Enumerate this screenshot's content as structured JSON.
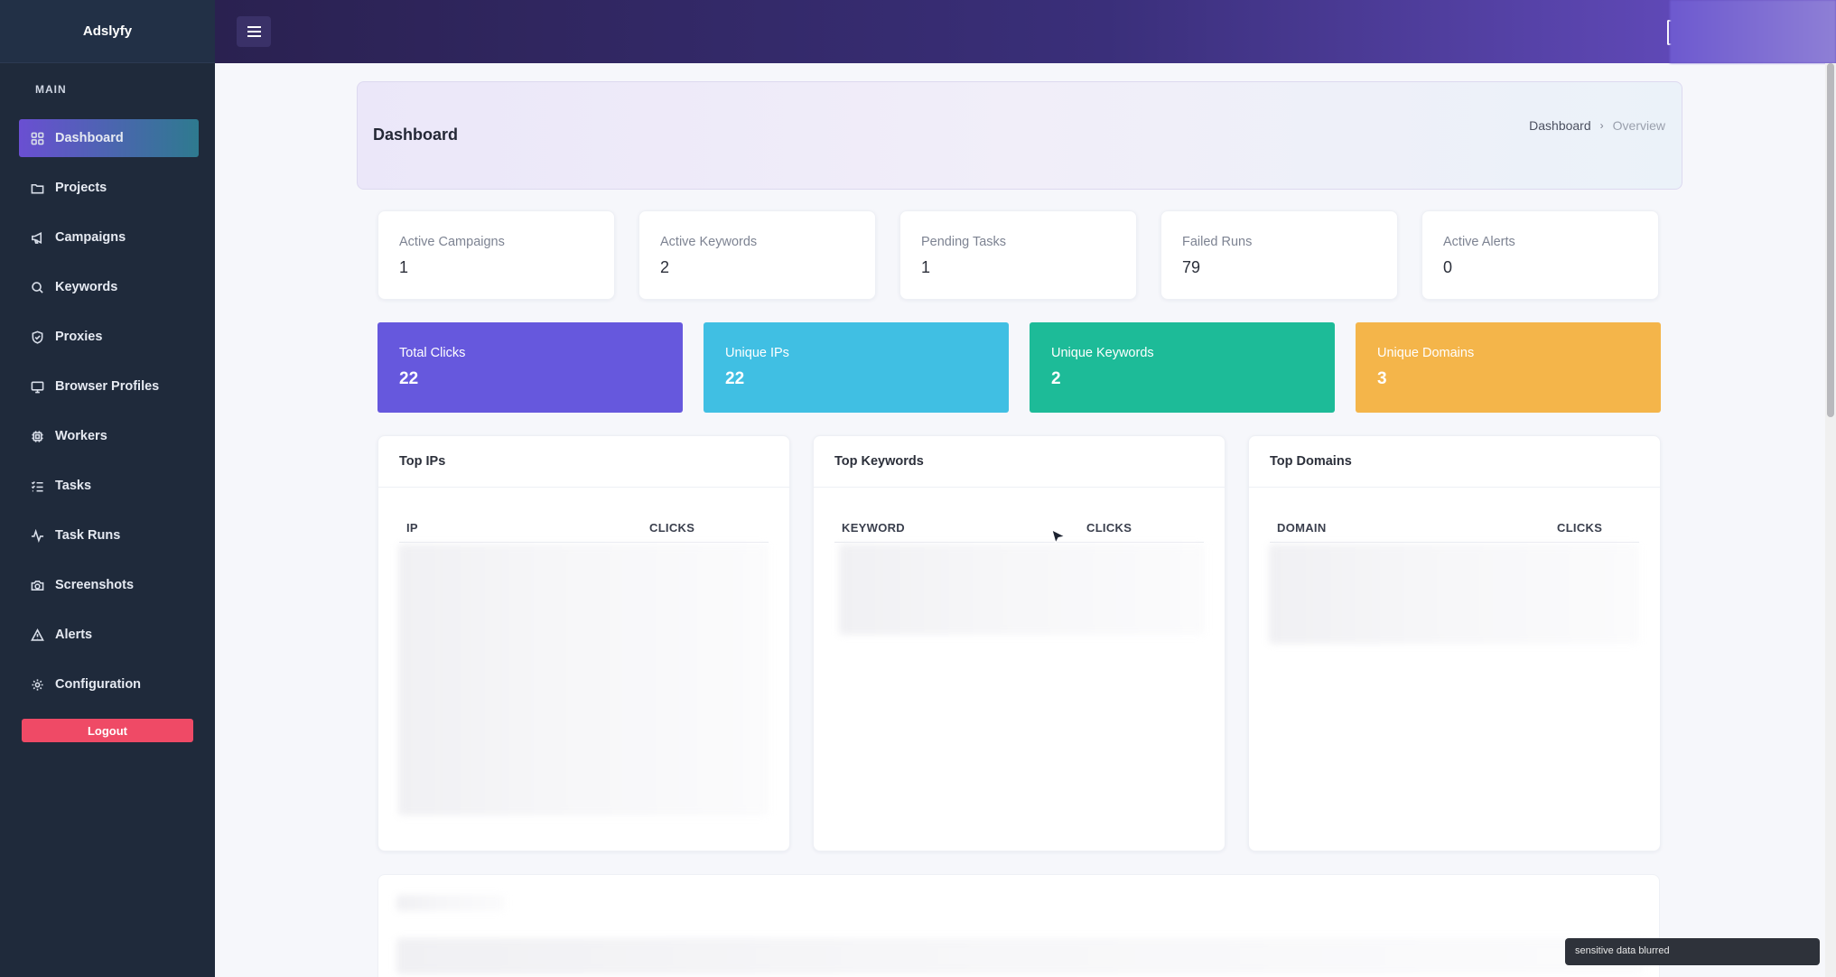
{
  "app": {
    "name": "Adslyfy"
  },
  "sidebar": {
    "section_label": "MAIN",
    "items": [
      {
        "label": "Dashboard",
        "icon": "grid-icon",
        "active": true
      },
      {
        "label": "Projects",
        "icon": "folder-icon"
      },
      {
        "label": "Campaigns",
        "icon": "megaphone-icon"
      },
      {
        "label": "Keywords",
        "icon": "search-icon"
      },
      {
        "label": "Proxies",
        "icon": "shield-icon"
      },
      {
        "label": "Browser Profiles",
        "icon": "monitor-icon"
      },
      {
        "label": "Workers",
        "icon": "cpu-icon"
      },
      {
        "label": "Tasks",
        "icon": "list-checks-icon"
      },
      {
        "label": "Task Runs",
        "icon": "activity-icon"
      },
      {
        "label": "Screenshots",
        "icon": "camera-icon"
      },
      {
        "label": "Alerts",
        "icon": "alert-triangle-icon"
      },
      {
        "label": "Configuration",
        "icon": "gear-icon"
      }
    ],
    "logout_label": "Logout"
  },
  "header": {
    "title": "Dashboard",
    "breadcrumb": [
      "Dashboard",
      "Overview"
    ]
  },
  "stats": [
    {
      "label": "Active Campaigns",
      "value": "1"
    },
    {
      "label": "Active Keywords",
      "value": "2"
    },
    {
      "label": "Pending Tasks",
      "value": "1"
    },
    {
      "label": "Failed Runs",
      "value": "79"
    },
    {
      "label": "Active Alerts",
      "value": "0"
    }
  ],
  "tiles": [
    {
      "label": "Total Clicks",
      "value": "22",
      "color": "#6658dd"
    },
    {
      "label": "Unique IPs",
      "value": "22",
      "color": "#40bfe3"
    },
    {
      "label": "Unique Keywords",
      "value": "2",
      "color": "#1dbb98"
    },
    {
      "label": "Unique Domains",
      "value": "3",
      "color": "#f4b54a"
    }
  ],
  "tables": [
    {
      "title": "Top IPs",
      "columns": [
        "IP",
        "CLICKS"
      ]
    },
    {
      "title": "Top Keywords",
      "columns": [
        "KEYWORD",
        "CLICKS"
      ]
    },
    {
      "title": "Top Domains",
      "columns": [
        "DOMAIN",
        "CLICKS"
      ]
    }
  ],
  "toast": {
    "text": "sensitive data blurred"
  },
  "colors": {
    "sidebar_bg": "#1f2a3b",
    "logout": "#ef4a66",
    "active_item_start": "#6a4fd2",
    "active_item_end": "#2e7a8f"
  }
}
